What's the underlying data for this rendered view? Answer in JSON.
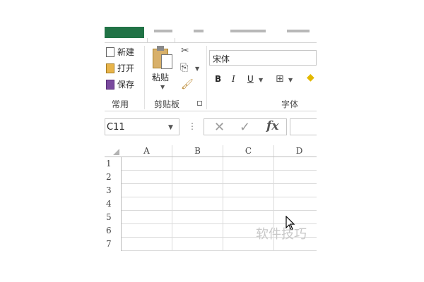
{
  "ribbon": {
    "clipboard_ext": {
      "new_label": "新建",
      "open_label": "打开",
      "save_label": "保存",
      "group_label": "常用"
    },
    "clipboard": {
      "paste_label": "粘贴",
      "group_label": "剪贴板"
    },
    "font": {
      "font_name": "宋体",
      "bold": "B",
      "italic": "I",
      "underline": "U",
      "group_label": "字体"
    }
  },
  "formula_bar": {
    "name_box": "C11",
    "cancel_icon": "✕",
    "enter_icon": "✓",
    "fx_label": "fx"
  },
  "sheet": {
    "columns": [
      "A",
      "B",
      "C",
      "D"
    ],
    "rows": [
      "1",
      "2",
      "3",
      "4",
      "5",
      "6",
      "7"
    ]
  },
  "watermark": "软件技巧",
  "colors": {
    "file_tab": "#217346",
    "grid_line": "#dadada"
  }
}
